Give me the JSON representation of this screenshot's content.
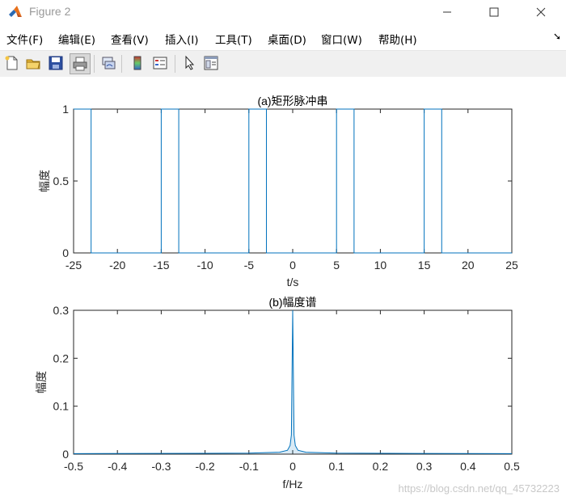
{
  "window": {
    "title": "Figure 2"
  },
  "menu": {
    "file": "文件(F)",
    "edit": "编辑(E)",
    "view": "查看(V)",
    "insert": "插入(I)",
    "tools": "工具(T)",
    "desktop": "桌面(D)",
    "window": "窗口(W)",
    "help": "帮助(H)"
  },
  "toolbar": {
    "icons": [
      "new-figure-icon",
      "open-folder-icon",
      "save-icon",
      "print-icon",
      "link-plot-icon",
      "colorbar-icon",
      "legend-icon",
      "pointer-icon",
      "property-editor-icon"
    ]
  },
  "colors": {
    "line": "#0072BD",
    "axes": "#262626",
    "toolbar_bg": "#f0f0f0"
  },
  "chart_data": [
    {
      "type": "line",
      "title": "(a)矩形脉冲串",
      "xlabel": "t/s",
      "ylabel": "幅度",
      "xlim": [
        -25,
        25
      ],
      "ylim": [
        0,
        1
      ],
      "xticks": [
        "-25",
        "-20",
        "-15",
        "-10",
        "-5",
        "0",
        "5",
        "10",
        "15",
        "20",
        "25"
      ],
      "yticks": [
        "0",
        "0.5",
        "1"
      ],
      "x": [
        -25,
        -23,
        -23,
        -15,
        -15,
        -13,
        -13,
        -5,
        -5,
        -3,
        -3,
        5,
        5,
        7,
        7,
        15,
        15,
        17,
        17,
        25
      ],
      "y": [
        1,
        1,
        0,
        0,
        1,
        1,
        0,
        0,
        1,
        1,
        0,
        0,
        1,
        1,
        0,
        0,
        1,
        1,
        0,
        0
      ]
    },
    {
      "type": "line",
      "title": "(b)幅度谱",
      "xlabel": "f/Hz",
      "ylabel": "幅度",
      "xlim": [
        -0.5,
        0.5
      ],
      "ylim": [
        0,
        0.3
      ],
      "xticks": [
        "-0.5",
        "-0.4",
        "-0.3",
        "-0.2",
        "-0.1",
        "0",
        "0.1",
        "0.2",
        "0.3",
        "0.4",
        "0.5"
      ],
      "yticks": [
        "0",
        "0.1",
        "0.2",
        "0.3"
      ],
      "x": [
        -0.5,
        -0.1,
        -0.03,
        -0.012,
        -0.006,
        -0.003,
        0,
        0.003,
        0.006,
        0.012,
        0.03,
        0.1,
        0.5
      ],
      "y": [
        0.001,
        0.002,
        0.004,
        0.008,
        0.018,
        0.04,
        0.3,
        0.04,
        0.018,
        0.008,
        0.004,
        0.002,
        0.001
      ]
    }
  ],
  "watermark": "https://blog.csdn.net/qq_45732223"
}
